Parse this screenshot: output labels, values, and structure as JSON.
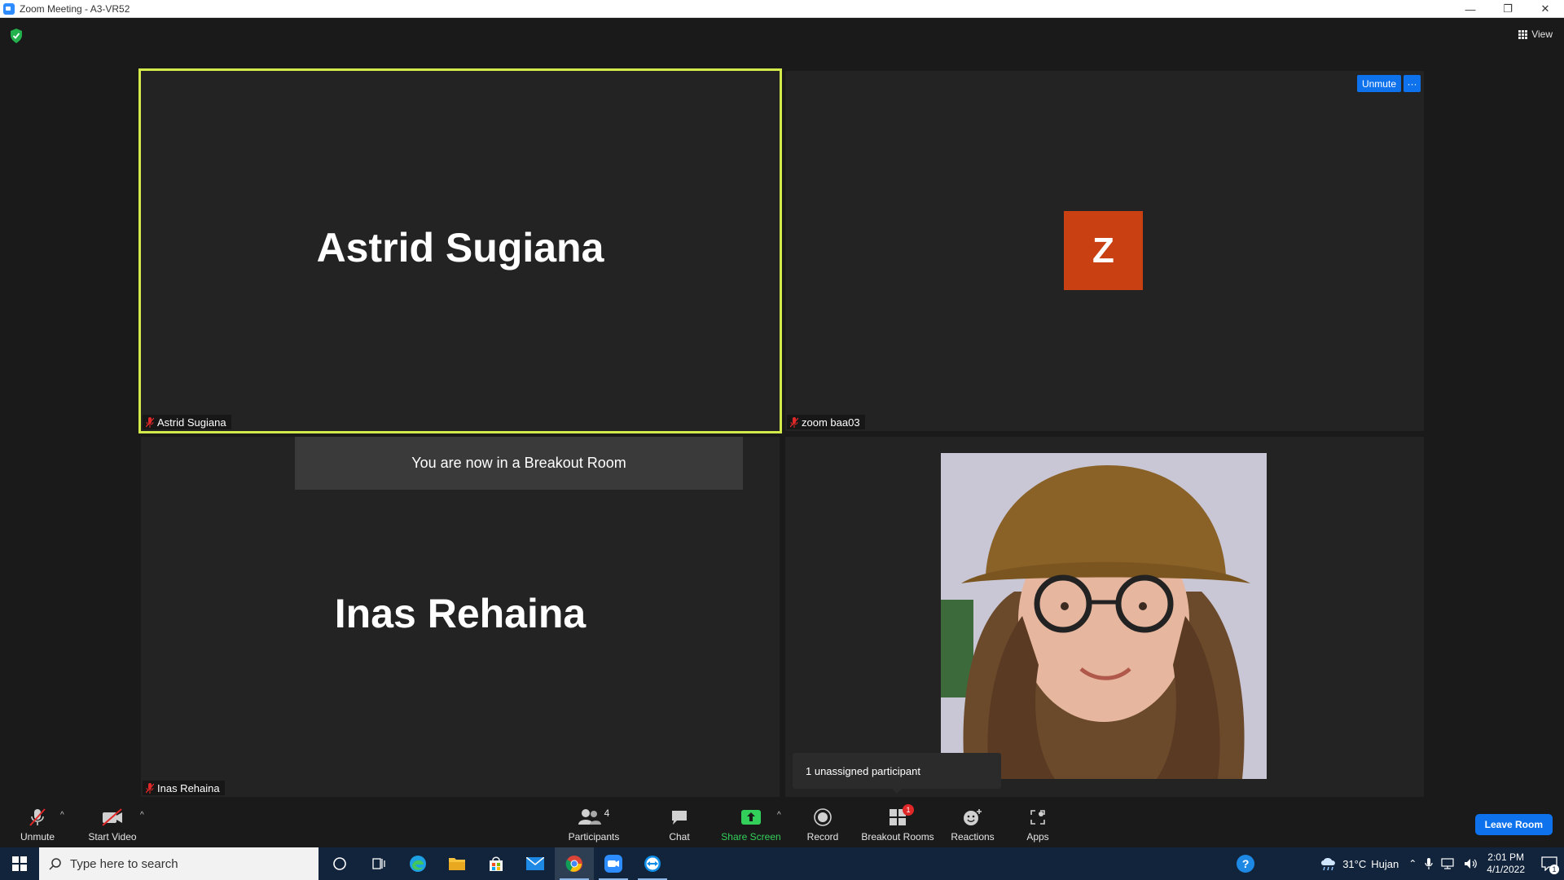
{
  "window": {
    "title": "Zoom Meeting - A3-VR52",
    "controls": {
      "minimize": "—",
      "restore": "❐",
      "close": "✕"
    }
  },
  "top_bar": {
    "view_label": "View",
    "shield_color": "#23b14d"
  },
  "tiles": [
    {
      "id": "tile1",
      "display_name": "Astrid Sugiana",
      "name_tag": "Astrid Sugiana",
      "active_speaker": true,
      "highlight_color": "#d4ea4a",
      "muted": true
    },
    {
      "id": "tile2",
      "avatar_letter": "Z",
      "avatar_color": "#c94012",
      "name_tag": "zoom baa03",
      "muted": true,
      "unmute_label": "Unmute",
      "more_label": "···"
    },
    {
      "id": "tile3",
      "display_name": "Inas Rehaina",
      "name_tag": "Inas Rehaina",
      "muted": true
    },
    {
      "id": "tile4",
      "video_on": true,
      "muted": true
    }
  ],
  "breakout_banner": "You are now in a Breakout Room",
  "unassigned_tooltip": "1 unassigned participant",
  "toolbar": {
    "unmute": "Unmute",
    "start_video": "Start Video",
    "participants": "Participants",
    "participants_count": "4",
    "chat": "Chat",
    "share_screen": "Share Screen",
    "record": "Record",
    "breakout_rooms": "Breakout Rooms",
    "breakout_badge": "1",
    "reactions": "Reactions",
    "apps": "Apps",
    "leave_room": "Leave Room",
    "caret": "^"
  },
  "taskbar": {
    "search_placeholder": "Type here to search",
    "apps": [
      "cortana-icon",
      "task-view-icon",
      "edge-icon",
      "file-explorer-icon",
      "microsoft-store-icon",
      "mail-icon",
      "chrome-icon",
      "zoom-icon",
      "teamviewer-icon"
    ],
    "help_label": "?",
    "weather_temp": "31°C",
    "weather_text": "Hujan",
    "time": "2:01 PM",
    "date": "4/1/2022",
    "notification_count": "1"
  },
  "colors": {
    "accent_blue": "#0e72ed",
    "share_green": "#32d05a",
    "taskbar_bg": "#12243c"
  }
}
